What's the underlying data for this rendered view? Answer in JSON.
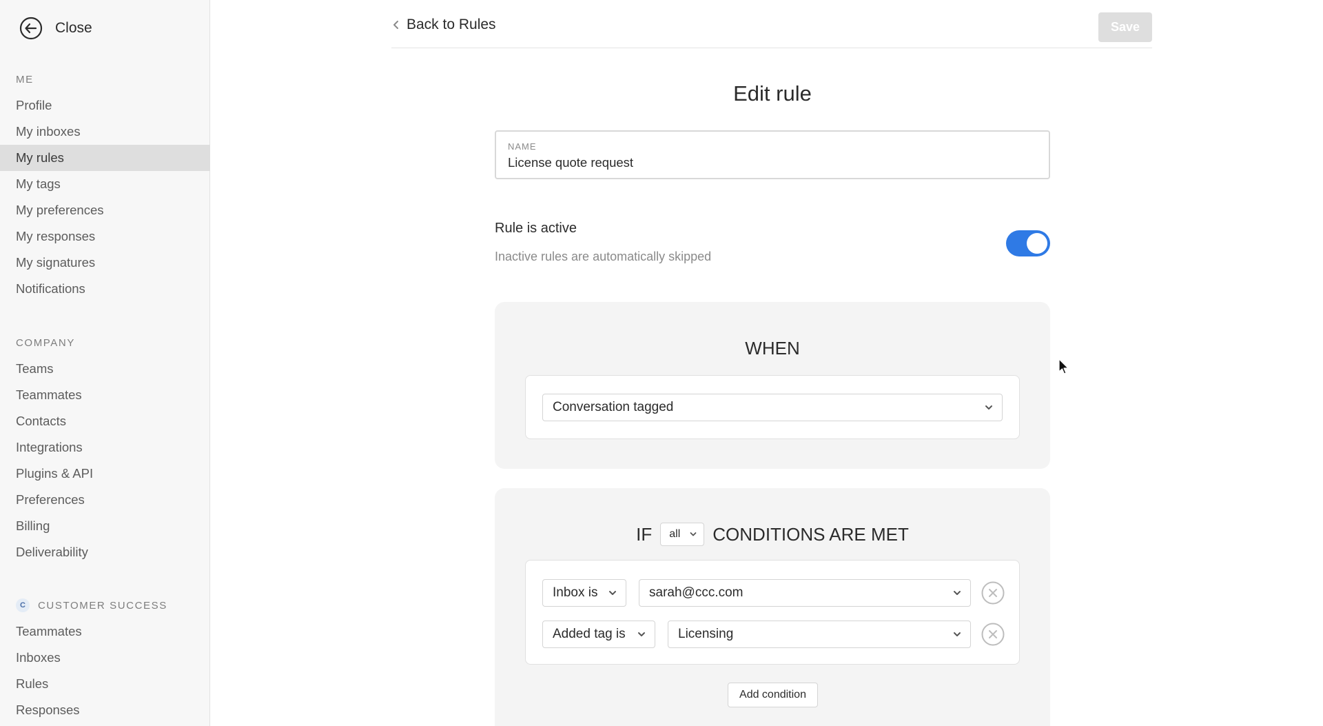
{
  "sidebar": {
    "close_label": "Close",
    "me_section": {
      "label": "ME",
      "items": [
        {
          "label": "Profile"
        },
        {
          "label": "My inboxes"
        },
        {
          "label": "My rules",
          "selected": true
        },
        {
          "label": "My tags"
        },
        {
          "label": "My preferences"
        },
        {
          "label": "My responses"
        },
        {
          "label": "My signatures"
        },
        {
          "label": "Notifications"
        }
      ]
    },
    "company_section": {
      "label": "COMPANY",
      "items": [
        {
          "label": "Teams"
        },
        {
          "label": "Teammates"
        },
        {
          "label": "Contacts"
        },
        {
          "label": "Integrations"
        },
        {
          "label": "Plugins & API"
        },
        {
          "label": "Preferences"
        },
        {
          "label": "Billing"
        },
        {
          "label": "Deliverability"
        }
      ]
    },
    "team_section": {
      "badge": "C",
      "label": "CUSTOMER SUCCESS",
      "items": [
        {
          "label": "Teammates"
        },
        {
          "label": "Inboxes"
        },
        {
          "label": "Rules"
        },
        {
          "label": "Responses"
        }
      ]
    }
  },
  "header": {
    "back_label": "Back to Rules",
    "save_label": "Save"
  },
  "form": {
    "title": "Edit rule",
    "name_label": "NAME",
    "name_value": "License quote request",
    "active_title": "Rule is active",
    "active_desc": "Inactive rules are automatically skipped",
    "active": true
  },
  "when": {
    "heading": "WHEN",
    "trigger": "Conversation tagged"
  },
  "conditions": {
    "if_word": "IF",
    "match_mode": "all",
    "are_met": "CONDITIONS ARE MET",
    "rows": [
      {
        "field": "Inbox is",
        "value": "sarah@ccc.com"
      },
      {
        "field": "Added tag is",
        "value": "Licensing"
      }
    ],
    "add_label": "Add condition"
  },
  "colors": {
    "accent": "#2f7ae5",
    "selected_bg": "#dedede",
    "panel_bg": "#f4f4f4"
  }
}
